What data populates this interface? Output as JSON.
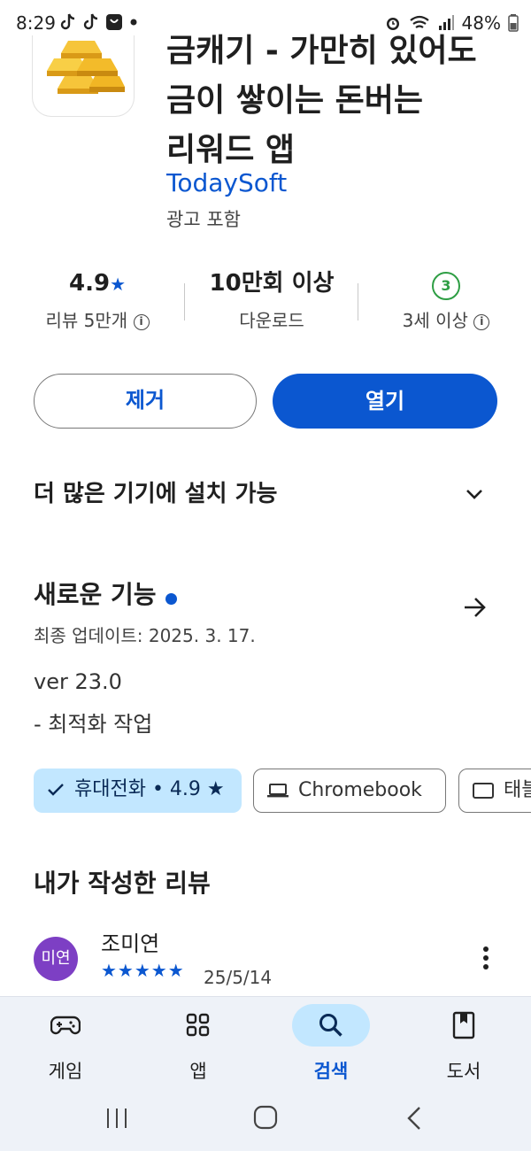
{
  "status_bar": {
    "time": "8:29",
    "battery": "48%"
  },
  "app": {
    "title": "금캐기 - 가만히 있어도\n금이 쌓이는 돈버는\n리워드 앱",
    "developer": "TodaySoft",
    "ads_label": "광고 포함"
  },
  "stats": {
    "rating": "4.9",
    "rating_star": "★",
    "reviews_label": "리뷰 5만개",
    "downloads_value": "10만회 이상",
    "downloads_label": "다운로드",
    "age_badge": "3",
    "age_label": "3세 이상",
    "info_glyph": "i"
  },
  "actions": {
    "remove_label": "제거",
    "open_label": "열기"
  },
  "more_devices": {
    "label": "더 많은 기기에 설치 가능"
  },
  "whats_new": {
    "title": "새로운 기능",
    "updated": "최종 업데이트: 2025. 3. 17.",
    "version": "ver 23.0",
    "note": "- 최적화 작업"
  },
  "device_chips": {
    "phone": "휴대전화 • 4.9 ★",
    "chromebook": "Chromebook",
    "tablet": "태블릿"
  },
  "my_review": {
    "title": "내가 작성한 리뷰",
    "avatar_text": "미연",
    "name": "조미연",
    "stars": "★★★★★",
    "rating": 5,
    "date": "25/5/14"
  },
  "bottom_nav": {
    "items": [
      {
        "label": "게임",
        "icon": "gamepad-icon"
      },
      {
        "label": "앱",
        "icon": "apps-grid-icon"
      },
      {
        "label": "검색",
        "icon": "search-icon",
        "active": true
      },
      {
        "label": "도서",
        "icon": "book-icon"
      }
    ]
  },
  "colors": {
    "accent": "#0b57d0",
    "chip_selected": "#c2e7ff",
    "age_green": "#2e9e44",
    "avatar": "#7d3fc4"
  }
}
